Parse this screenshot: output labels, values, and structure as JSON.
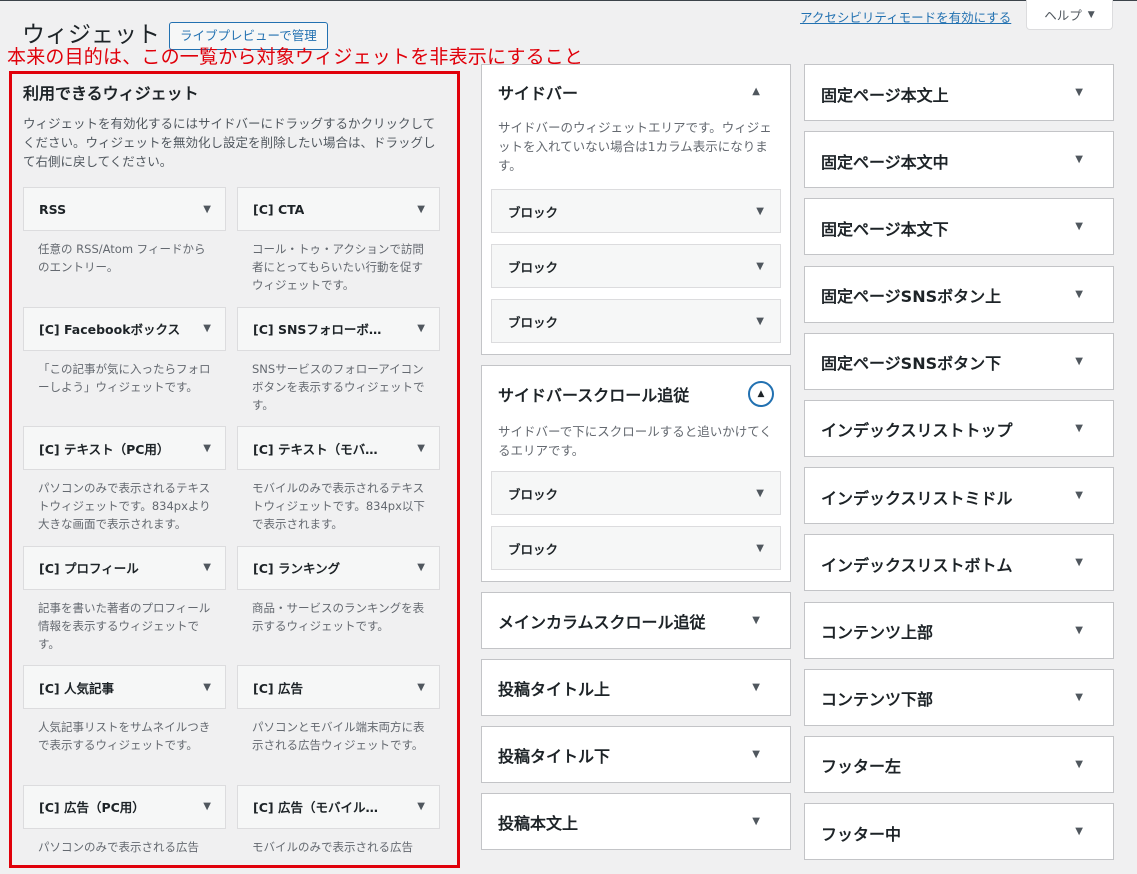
{
  "header": {
    "title": "ウィジェット",
    "preview_button": "ライブプレビューで管理",
    "a11y_link": "アクセシビリティモードを有効にする",
    "help": "ヘルプ"
  },
  "annotation": "本来の目的は、この一覧から対象ウィジェットを非表示にすること",
  "available": {
    "title": "利用できるウィジェット",
    "description": "ウィジェットを有効化するにはサイドバーにドラッグするかクリックしてください。ウィジェットを無効化し設定を削除したい場合は、ドラッグして右側に戻してください。",
    "widgets": [
      {
        "title": "RSS",
        "desc": "任意の RSS/Atom フィードからのエントリー。"
      },
      {
        "title": "[C] CTA",
        "desc": "コール・トゥ・アクションで訪問者にとってもらいたい行動を促すウィジェットです。"
      },
      {
        "title": "[C] Facebookボックス",
        "desc": "「この記事が気に入ったらフォローしよう」ウィジェットです。"
      },
      {
        "title": "[C] SNSフォローボ…",
        "desc": "SNSサービスのフォローアイコンボタンを表示するウィジェットです。"
      },
      {
        "title": "[C] テキスト（PC用）",
        "desc": "パソコンのみで表示されるテキストウィジェットです。834pxより大きな画面で表示されます。"
      },
      {
        "title": "[C] テキスト（モバ…",
        "desc": "モバイルのみで表示されるテキストウィジェットです。834px以下で表示されます。"
      },
      {
        "title": "[C] プロフィール",
        "desc": "記事を書いた著者のプロフィール情報を表示するウィジェットです。"
      },
      {
        "title": "[C] ランキング",
        "desc": "商品・サービスのランキングを表示するウィジェットです。"
      },
      {
        "title": "[C] 人気記事",
        "desc": "人気記事リストをサムネイルつきで表示するウィジェットです。"
      },
      {
        "title": "[C] 広告",
        "desc": "パソコンとモバイル端末両方に表示される広告ウィジェットです。"
      },
      {
        "title": "[C] 広告（PC用）",
        "desc": "パソコンのみで表示される広告"
      },
      {
        "title": "[C] 広告（モバイル…",
        "desc": "モバイルのみで表示される広告"
      }
    ]
  },
  "sidebar": {
    "title": "サイドバー",
    "description": "サイドバーのウィジェットエリアです。ウィジェットを入れていない場合は1カラム表示になります。",
    "blocks": [
      "ブロック",
      "ブロック",
      "ブロック"
    ]
  },
  "sidebar_scroll": {
    "title": "サイドバースクロール追従",
    "description": "サイドバーで下にスクロールすると追いかけてくるエリアです。",
    "blocks": [
      "ブロック",
      "ブロック"
    ]
  },
  "col2_areas": [
    "メインカラムスクロール追従",
    "投稿タイトル上",
    "投稿タイトル下",
    "投稿本文上"
  ],
  "col3_areas": [
    "固定ページ本文上",
    "固定ページ本文中",
    "固定ページ本文下",
    "固定ページSNSボタン上",
    "固定ページSNSボタン下",
    "インデックスリストトップ",
    "インデックスリストミドル",
    "インデックスリストボトム",
    "コンテンツ上部",
    "コンテンツ下部",
    "フッター左",
    "フッター中"
  ],
  "colors": {
    "annotation": "#e0000a",
    "link": "#2271b1",
    "background": "#f0f0f1"
  }
}
